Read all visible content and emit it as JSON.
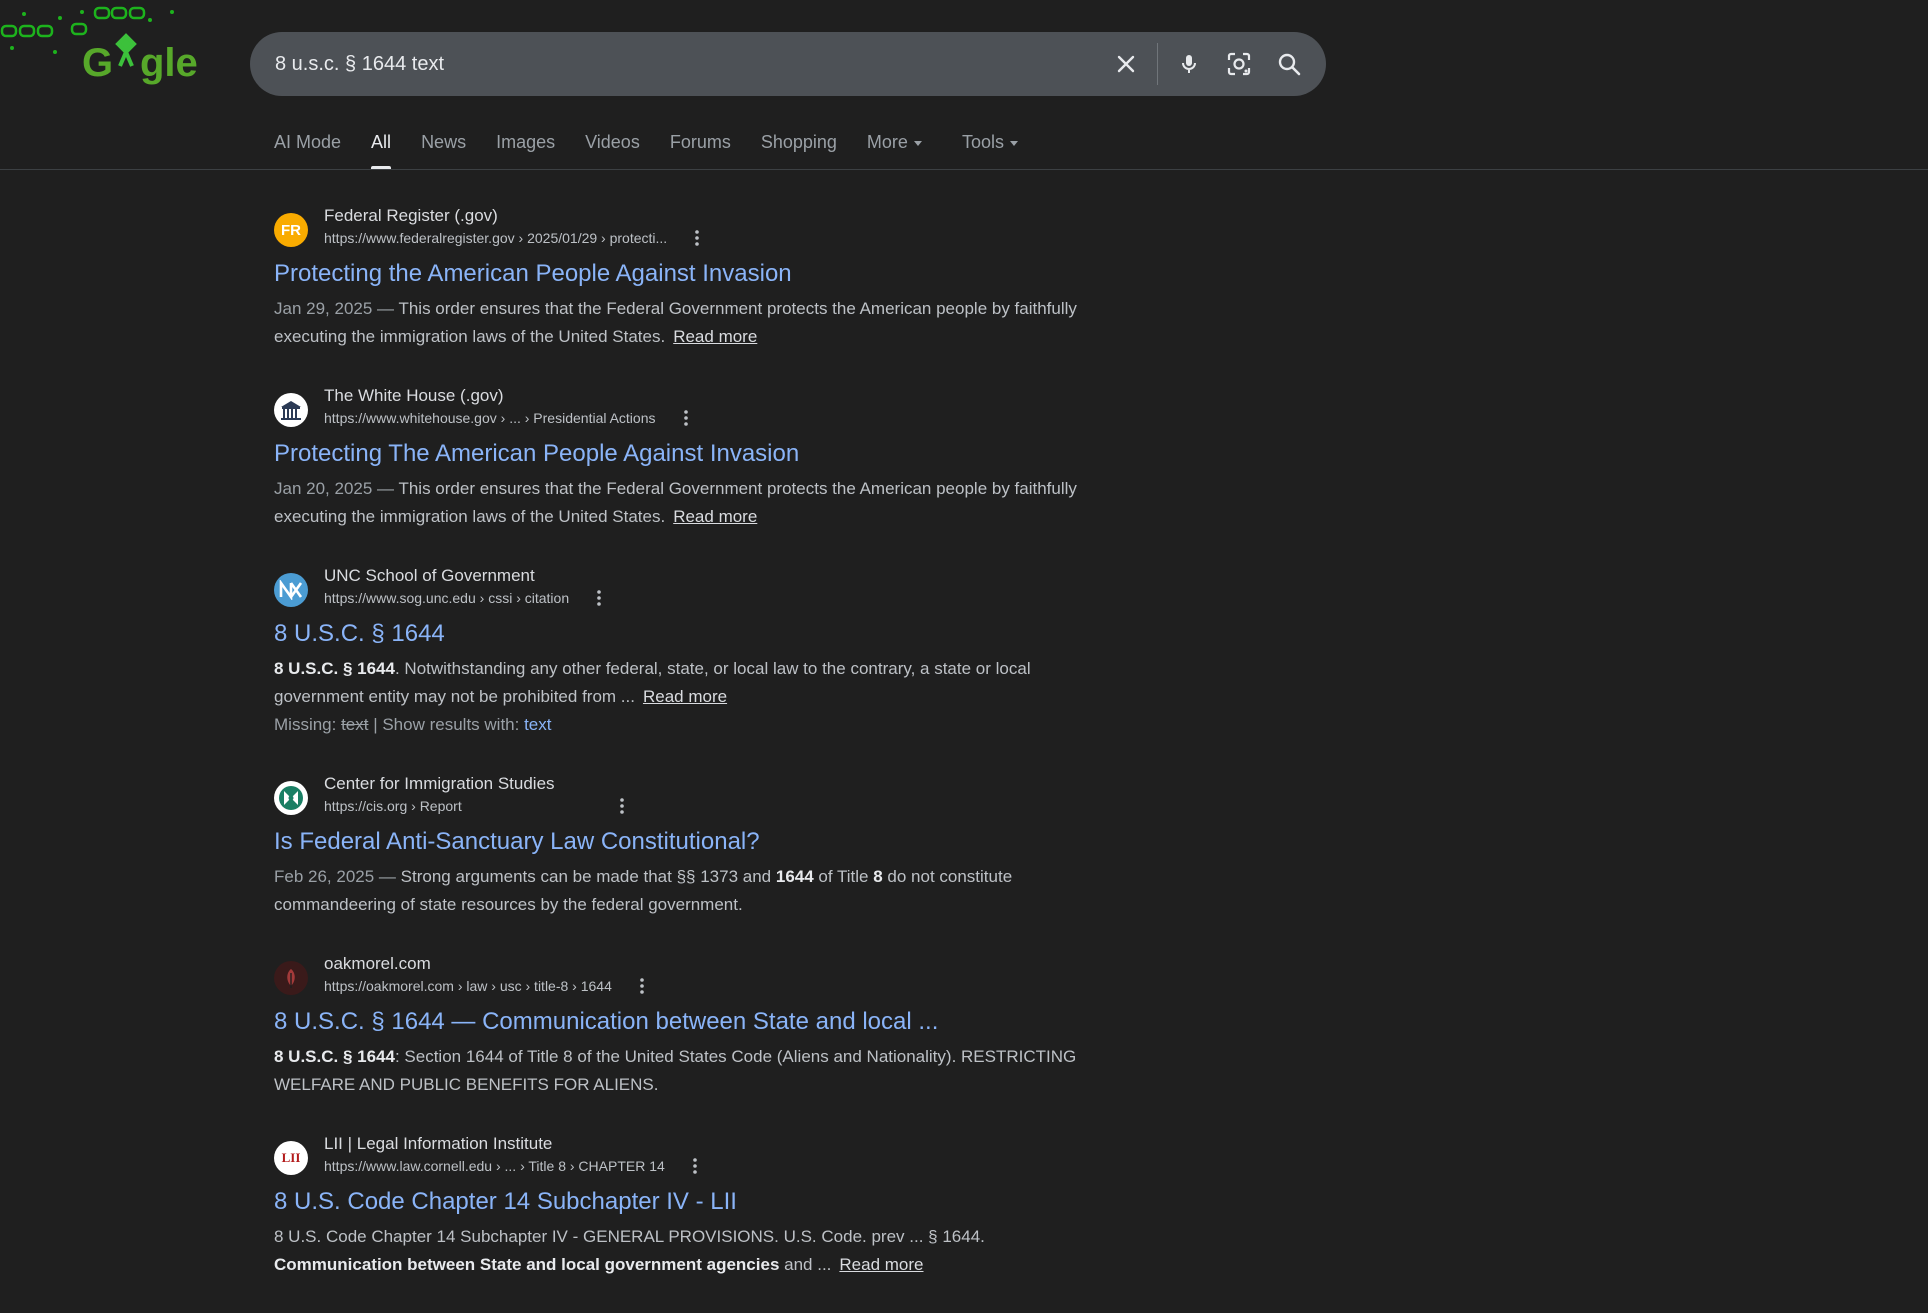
{
  "search": {
    "query": "8 u.s.c. § 1644 text",
    "clear_icon": "close-icon",
    "voice_icon": "mic-icon",
    "lens_icon": "camera-lens-icon",
    "search_icon": "search-icon"
  },
  "logo": {
    "icon": "doodle-logo"
  },
  "tabs": [
    {
      "label": "AI Mode",
      "active": false
    },
    {
      "label": "All",
      "active": true
    },
    {
      "label": "News",
      "active": false
    },
    {
      "label": "Images",
      "active": false
    },
    {
      "label": "Videos",
      "active": false
    },
    {
      "label": "Forums",
      "active": false
    },
    {
      "label": "Shopping",
      "active": false
    },
    {
      "label": "More",
      "active": false
    },
    {
      "label": "Tools",
      "active": false
    }
  ],
  "results": [
    {
      "site": "Federal Register (.gov)",
      "url": "https://www.federalregister.gov › 2025/01/29 › protecti...",
      "title": "Protecting the American People Against Invasion",
      "date": "Jan 29, 2025 — ",
      "snippet": "This order ensures that the Federal Government protects the American people by faithfully executing the immigration laws of the United States.",
      "read_more": "Read more"
    },
    {
      "site": "The White House (.gov)",
      "url": "https://www.whitehouse.gov › ... › Presidential Actions",
      "title": "Protecting The American People Against Invasion",
      "date": "Jan 20, 2025 — ",
      "snippet": "This order ensures that the Federal Government protects the American people by faithfully executing the immigration laws of the United States.",
      "read_more": "Read more"
    },
    {
      "site": "UNC School of Government",
      "url": "https://www.sog.unc.edu › cssi › citation",
      "title": "8 U.S.C. § 1644",
      "snippet_bold": "8 U.S.C. § 1644",
      "snippet": ". Notwithstanding any other federal, state, or local law to the contrary, a state or local government entity may not be prohibited from ...",
      "read_more": "Read more",
      "missing_label": "Missing: ",
      "missing_term": "text",
      "show_label": " | Show results with: ",
      "show_term": "text"
    },
    {
      "site": "Center for Immigration Studies",
      "url": "https://cis.org › Report",
      "title": "Is Federal Anti-Sanctuary Law Constitutional?",
      "date": "Feb 26, 2025 — ",
      "snippet_a": "Strong arguments can be made that §§ 1373 and ",
      "snippet_b1": "1644",
      "snippet_c": " of Title ",
      "snippet_b2": "8",
      "snippet_d": " do not constitute commandeering of state resources by the federal government."
    },
    {
      "site": "oakmorel.com",
      "url": "https://oakmorel.com › law › usc › title-8 › 1644",
      "title": "8 U.S.C. § 1644 — Communication between State and local ...",
      "snippet_bold": "8 U.S.C. § 1644",
      "snippet": ": Section 1644 of Title 8 of the United States Code (Aliens and Nationality). RESTRICTING WELFARE AND PUBLIC BENEFITS FOR ALIENS."
    },
    {
      "site": "LII | Legal Information Institute",
      "url": "https://www.law.cornell.edu › ... › Title 8 › CHAPTER 14",
      "title": "8 U.S. Code Chapter 14 Subchapter IV - LII",
      "snippet": "8 U.S. Code Chapter 14 Subchapter IV - GENERAL PROVISIONS. U.S. Code. prev ... § 1644.",
      "snippet_bold": "Communication between State and local government agencies",
      "snippet_tail": " and ...",
      "read_more": "Read more"
    }
  ],
  "favicons": [
    {
      "icon": "federal-register-icon",
      "text": "FR",
      "bg": "#f9ab00",
      "fg": "#ffffff"
    },
    {
      "icon": "white-house-icon",
      "bg": "#ffffff"
    },
    {
      "icon": "unc-icon",
      "bg": "#4b9cd3"
    },
    {
      "icon": "cis-icon",
      "bg": "#ffffff"
    },
    {
      "icon": "oakmorel-icon",
      "bg": "#3a1a1a"
    },
    {
      "icon": "lii-icon",
      "text": "LII",
      "bg": "#ffffff",
      "fg": "#b31b1b"
    }
  ]
}
